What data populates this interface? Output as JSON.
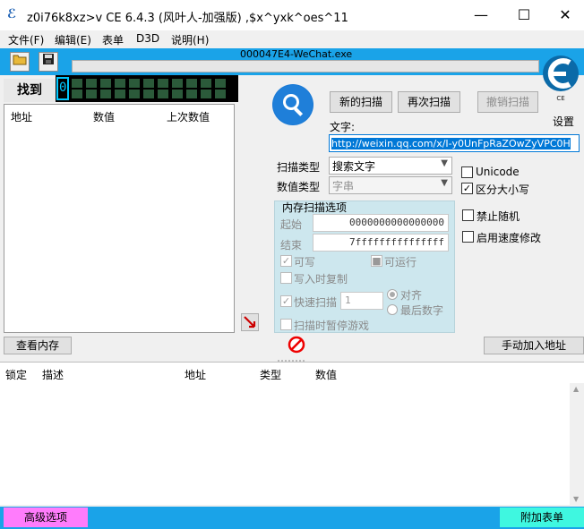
{
  "window": {
    "title": "z0i76k8xz>v  CE 6.4.3 (风叶人-加强版) ,$x^yxk^oes^11",
    "minimize_glyph": "—",
    "maximize_glyph": "☐",
    "close_glyph": "✕"
  },
  "menu": [
    {
      "label": "文件(F)"
    },
    {
      "label": "编辑(E)"
    },
    {
      "label": "表单"
    },
    {
      "label": "D3D"
    },
    {
      "label": "说明(H)"
    }
  ],
  "process": {
    "name": "000047E4-WeChat.exe"
  },
  "found": {
    "label": "找到",
    "count_digit": "0"
  },
  "results": {
    "headers": [
      "地址",
      "数值",
      "上次数值"
    ]
  },
  "scan": {
    "new_scan": "新的扫描",
    "next_scan": "再次扫描",
    "undo_scan": "撤销扫描",
    "settings": "设置",
    "text_label": "文字:",
    "text_value": "http://weixin.qq.com/x/I-y0UnFpRaZOwZyVPC0H",
    "scan_type_label": "扫描类型",
    "scan_type_value": "搜索文字",
    "value_type_label": "数值类型",
    "value_type_value": "字串",
    "unicode": "Unicode",
    "case_sensitive": "区分大小写",
    "disable_random": "禁止随机",
    "speedhack": "启用速度修改"
  },
  "memory": {
    "title": "内存扫描选项",
    "start_label": "起始",
    "start_value": "0000000000000000",
    "end_label": "结束",
    "end_value": "7fffffffffffffff",
    "writable": "可写",
    "executable": "可运行",
    "copy_on_write": "写入时复制",
    "fast_scan": "快速扫描",
    "fast_scan_value": "1",
    "alignment": "对齐",
    "last_digits": "最后数字",
    "pause_game": "扫描时暂停游戏"
  },
  "actions": {
    "view_memory": "查看内存",
    "add_address": "手动加入地址"
  },
  "table": {
    "headers": [
      "锁定",
      "描述",
      "地址",
      "类型",
      "数值"
    ]
  },
  "bottom": {
    "advanced": "高级选项",
    "attach": "附加表单"
  },
  "colors": {
    "accent": "#1aa3e8",
    "advanced_bg": "#ff7cfc",
    "attach_bg": "#3ff7e0",
    "mem_panel_bg": "#cde7ee"
  },
  "icons": [
    "open-folder-icon",
    "save-disk-icon",
    "scan-magnifier-icon",
    "pointer-arrow-icon",
    "stop-icon",
    "ce-logo-icon"
  ]
}
